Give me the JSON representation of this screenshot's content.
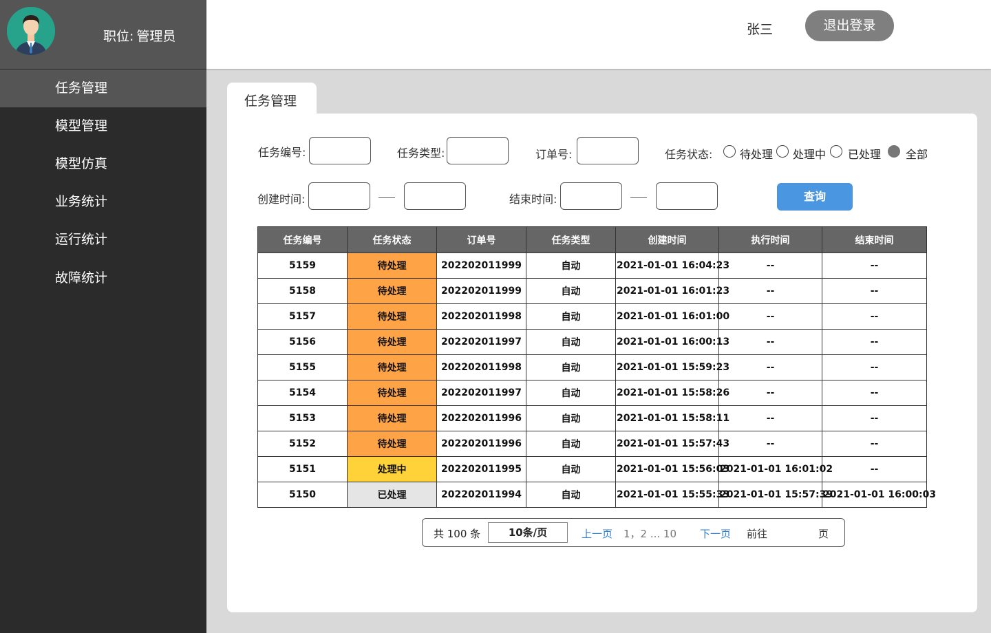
{
  "sidebar": {
    "role_label": "职位:",
    "role_value": "管理员",
    "items": [
      {
        "label": "任务管理"
      },
      {
        "label": "模型管理"
      },
      {
        "label": "模型仿真"
      },
      {
        "label": "业务统计"
      },
      {
        "label": "运行统计"
      },
      {
        "label": "故障统计"
      }
    ],
    "active_index": 0
  },
  "header": {
    "username": "张三",
    "logout_label": "退出登录"
  },
  "tab": {
    "label": "任务管理"
  },
  "filters": {
    "task_id_label": "任务编号:",
    "task_type_label": "任务类型:",
    "order_no_label": "订单号:",
    "status_label": "任务状态:",
    "status_options": [
      "待处理",
      "处理中",
      "已处理",
      "全部"
    ],
    "status_selected": "全部",
    "created_label": "创建时间:",
    "end_label": "结束时间:",
    "query_label": "查询"
  },
  "table": {
    "headers": [
      "任务编号",
      "任务状态",
      "订单号",
      "任务类型",
      "创建时间",
      "执行时间",
      "结束时间"
    ],
    "rows": [
      [
        "5159",
        "待处理",
        "202202011999",
        "自动",
        "2021-01-01 16:04:23",
        "--",
        "--"
      ],
      [
        "5158",
        "待处理",
        "202202011999",
        "自动",
        "2021-01-01 16:01:23",
        "--",
        "--"
      ],
      [
        "5157",
        "待处理",
        "202202011998",
        "自动",
        "2021-01-01 16:01:00",
        "--",
        "--"
      ],
      [
        "5156",
        "待处理",
        "202202011997",
        "自动",
        "2021-01-01 16:00:13",
        "--",
        "--"
      ],
      [
        "5155",
        "待处理",
        "202202011998",
        "自动",
        "2021-01-01 15:59:23",
        "--",
        "--"
      ],
      [
        "5154",
        "待处理",
        "202202011997",
        "自动",
        "2021-01-01 15:58:26",
        "--",
        "--"
      ],
      [
        "5153",
        "待处理",
        "202202011996",
        "自动",
        "2021-01-01 15:58:11",
        "--",
        "--"
      ],
      [
        "5152",
        "待处理",
        "202202011996",
        "自动",
        "2021-01-01 15:57:43",
        "--",
        "--"
      ],
      [
        "5151",
        "处理中",
        "202202011995",
        "自动",
        "2021-01-01 15:56:03",
        "2021-01-01 16:01:02",
        "--"
      ],
      [
        "5150",
        "已处理",
        "202202011994",
        "自动",
        "2021-01-01 15:55:33",
        "2021-01-01 15:57:39",
        "2021-01-01 16:00:03"
      ]
    ]
  },
  "pagination": {
    "total": "共 100 条",
    "page_size": "10条/页",
    "prev": "上一页",
    "pages": "1，2 ... 10",
    "next": "下一页",
    "goto": "前往",
    "page_unit": "页"
  },
  "colors": {
    "pending": "#ffa347",
    "processing": "#ffd23a",
    "done": "#e5e5e5",
    "accent": "#4a96e0"
  }
}
